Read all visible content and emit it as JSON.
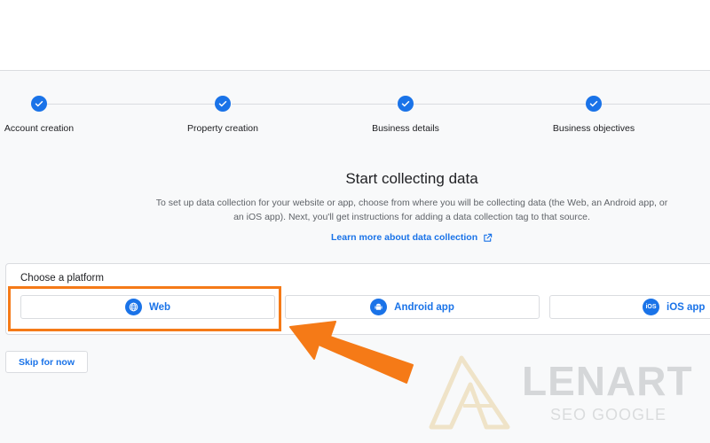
{
  "stepper": {
    "steps": [
      {
        "label": "Account creation",
        "status": "complete"
      },
      {
        "label": "Property creation",
        "status": "complete"
      },
      {
        "label": "Business details",
        "status": "complete"
      },
      {
        "label": "Business objectives",
        "status": "complete"
      }
    ]
  },
  "main": {
    "title": "Start collecting data",
    "description": "To set up data collection for your website or app, choose from where you will be collecting data (the Web, an Android app, or an iOS app). Next, you'll get instructions for adding a data collection tag to that source.",
    "learn_more_label": "Learn more about data collection",
    "learn_more_icon": "external-link-icon"
  },
  "platform": {
    "heading": "Choose a platform",
    "options": [
      {
        "label": "Web",
        "icon": "globe-icon"
      },
      {
        "label": "Android app",
        "icon": "android-icon"
      },
      {
        "label": "iOS app",
        "icon": "ios-icon",
        "icon_text": "iOS"
      }
    ]
  },
  "skip_label": "Skip for now",
  "watermark": {
    "brand": "LENART",
    "subtitle": "SEO GOOGLE"
  },
  "colors": {
    "accent": "#1a73e8",
    "highlight": "#f57a17",
    "background": "#f8f9fa"
  }
}
